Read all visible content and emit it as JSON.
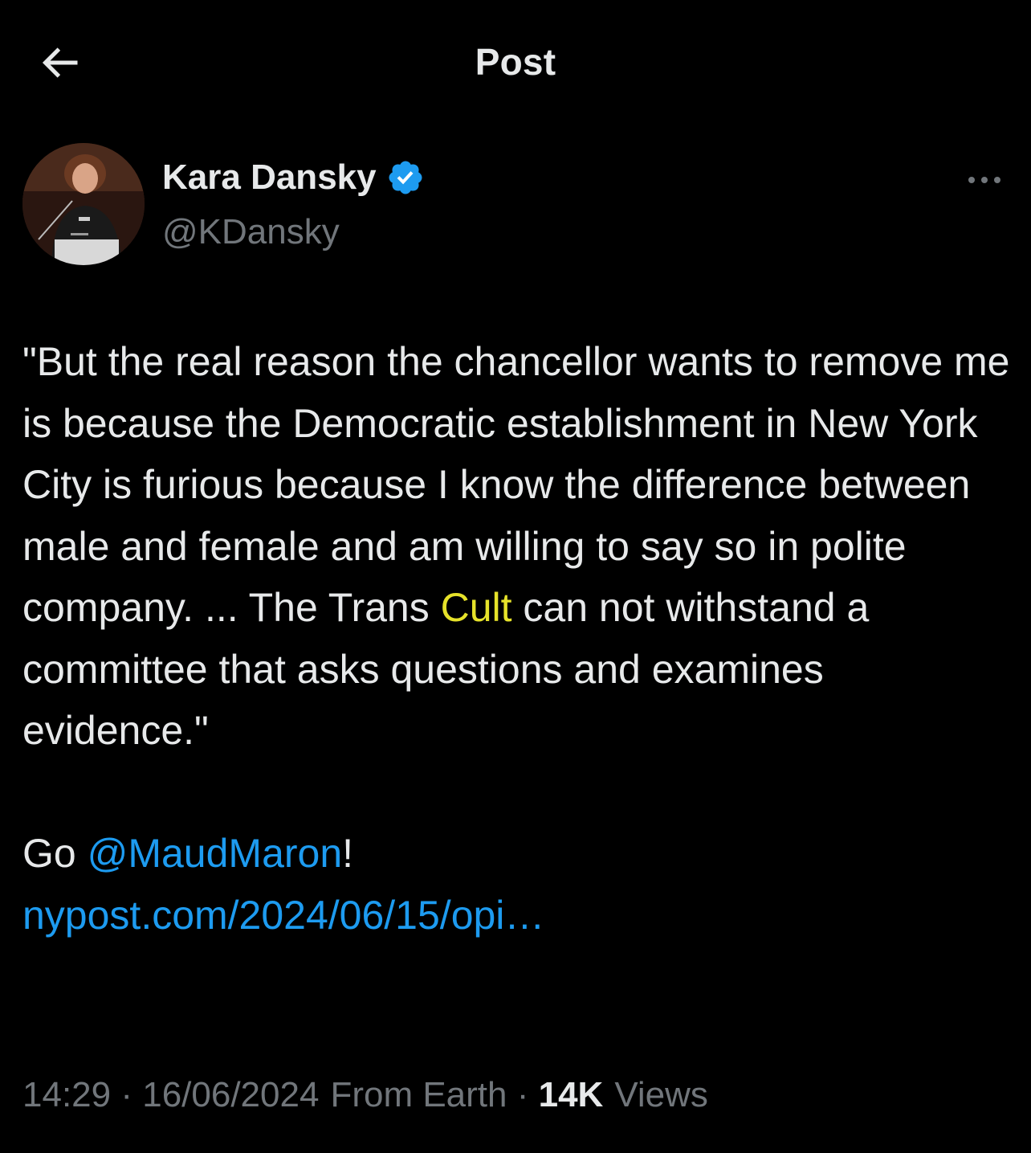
{
  "header": {
    "title": "Post",
    "back_icon": "arrow-left-icon"
  },
  "author": {
    "name": "Kara Dansky",
    "handle": "@KDansky",
    "verified": true,
    "verified_color": "#1d9bf0",
    "more_icon": "more-horizontal-icon"
  },
  "post": {
    "quote": "\"But the real reason the chancellor wants to remove me is because the Democratic establishment in New York City is furious because I know the difference between male and female and am willing to say so in polite company. ... The Trans ",
    "highlight_word": "Cult",
    "quote_end": " can not withstand a committee that asks questions and examines evidence.\"",
    "go_prefix": "Go ",
    "mention": "@MaudMaron",
    "go_suffix": "!",
    "link_text": "nypost.com/2024/06/15/opi…",
    "highlight_color": "#e6e22a",
    "link_color": "#1d9bf0"
  },
  "meta": {
    "time": "14:29",
    "separator": " · ",
    "date": "16/06/2024",
    "source": "From Earth",
    "views_count": "14K",
    "views_label": "Views"
  }
}
